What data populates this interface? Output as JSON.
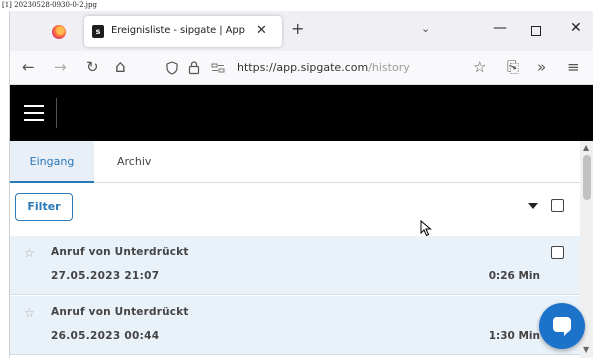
{
  "image_caption": "[1] 20230528-0930-0-2.jpg",
  "browser": {
    "tab_title": "Ereignisliste - sipgate | App",
    "tab_close": "✕",
    "new_tab": "+",
    "tabs_list": "⌄",
    "win_minimize": "—",
    "win_close": "✕",
    "url_domain": "https://app.sipgate.com",
    "url_path": "/history",
    "nav_back": "←",
    "nav_forward": "→",
    "nav_reload": "↻",
    "nav_home": "⌂",
    "bookmark_star": "☆",
    "extensions": "⎘",
    "overflow": "»",
    "menu": "≡"
  },
  "app": {
    "tabs": [
      {
        "label": "Eingang",
        "active": true
      },
      {
        "label": "Archiv",
        "active": false
      }
    ],
    "filter_label": "Filter",
    "events": [
      {
        "caller": "Anruf von Unterdrückt",
        "date": "27.05.2023 21:07",
        "duration": "0:26 Min",
        "starred": false
      },
      {
        "caller": "Anruf von Unterdrückt",
        "date": "26.05.2023 00:44",
        "duration": "1:30 Min",
        "starred": false
      }
    ],
    "star_glyph": "☆"
  },
  "colors": {
    "accent": "#2a79b9",
    "header_bg": "#000000",
    "row_bg": "#e9f1f9",
    "chat_fab": "#1d73c9"
  }
}
